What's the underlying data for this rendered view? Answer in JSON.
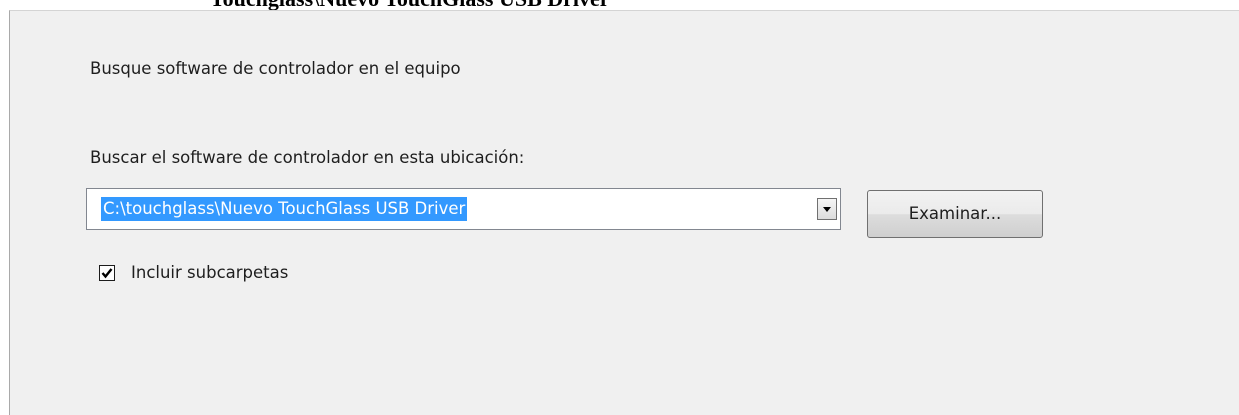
{
  "dialog": {
    "partial_title": "Touchglass\\Nuevo TouchGlass USB Driver",
    "heading": "Busque software de controlador en el equipo",
    "location_label": "Buscar el software de controlador en esta ubicación:",
    "path_value": "C:\\touchglass\\Nuevo TouchGlass USB Driver",
    "browse_label": "Examinar...",
    "include_subfolders_label": "Incluir subcarpetas",
    "include_subfolders_checked": true
  },
  "icons": {
    "dropdown": "chevron-down-icon",
    "checkmark": "checkmark-icon"
  },
  "colors": {
    "dialog_background": "#f0f0f0",
    "selection_highlight": "#3399ff"
  }
}
